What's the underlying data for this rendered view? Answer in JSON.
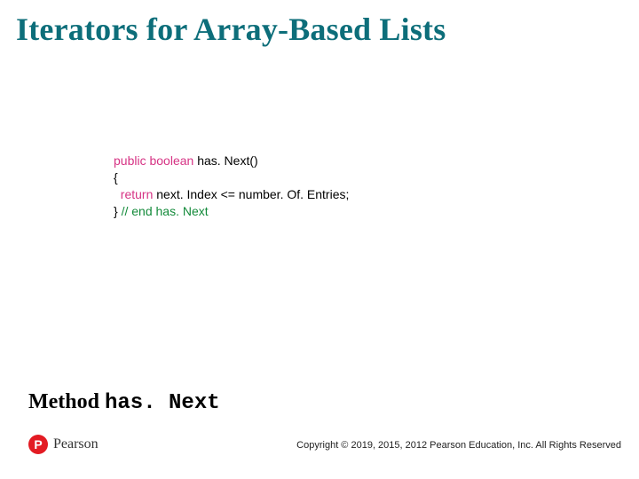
{
  "title": "Iterators for Array-Based Lists",
  "code": {
    "kw_public": "public",
    "kw_boolean": "boolean",
    "method_sig": " has. Next()",
    "brace_open": "{",
    "kw_return": "return",
    "return_expr": " next. Index <= number. Of. Entries;",
    "brace_close": "}",
    "end_comment": " // end has. Next"
  },
  "subtitle_prefix": "Method ",
  "subtitle_method": "has. Next",
  "publisher": "Pearson",
  "publisher_letter": "P",
  "copyright": "Copyright © 2019, 2015, 2012 Pearson Education, Inc. All Rights Reserved"
}
